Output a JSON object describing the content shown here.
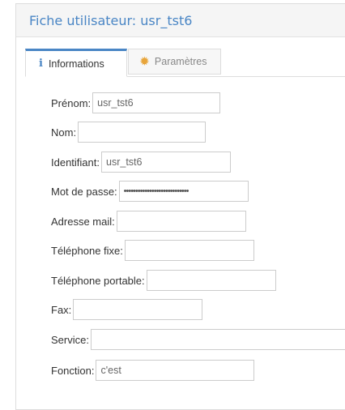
{
  "panel": {
    "title": "Fiche utilisateur: usr_tst6"
  },
  "tabs": [
    {
      "label": "Informations",
      "icon": "info-icon"
    },
    {
      "label": "Paramètres",
      "icon": "gear-icon"
    }
  ],
  "form": {
    "prenom": {
      "label": "Prénom:",
      "value": "usr_tst6"
    },
    "nom": {
      "label": "Nom:",
      "value": ""
    },
    "identifiant": {
      "label": "Identifiant:",
      "value": "usr_tst6"
    },
    "mot_de_passe": {
      "label": "Mot de passe:",
      "value": "••••••••••••••••••••••••••••"
    },
    "adresse_mail": {
      "label": "Adresse mail:",
      "value": ""
    },
    "telephone_fixe": {
      "label": "Téléphone fixe:",
      "value": ""
    },
    "telephone_portable": {
      "label": "Téléphone portable:",
      "value": ""
    },
    "fax": {
      "label": "Fax:",
      "value": ""
    },
    "service": {
      "label": "Service:",
      "value": ""
    },
    "fonction": {
      "label": "Fonction:",
      "value": "c'est"
    }
  },
  "colors": {
    "accent": "#4a86c5",
    "gear": "#e8a53a",
    "border": "#cccccc"
  }
}
